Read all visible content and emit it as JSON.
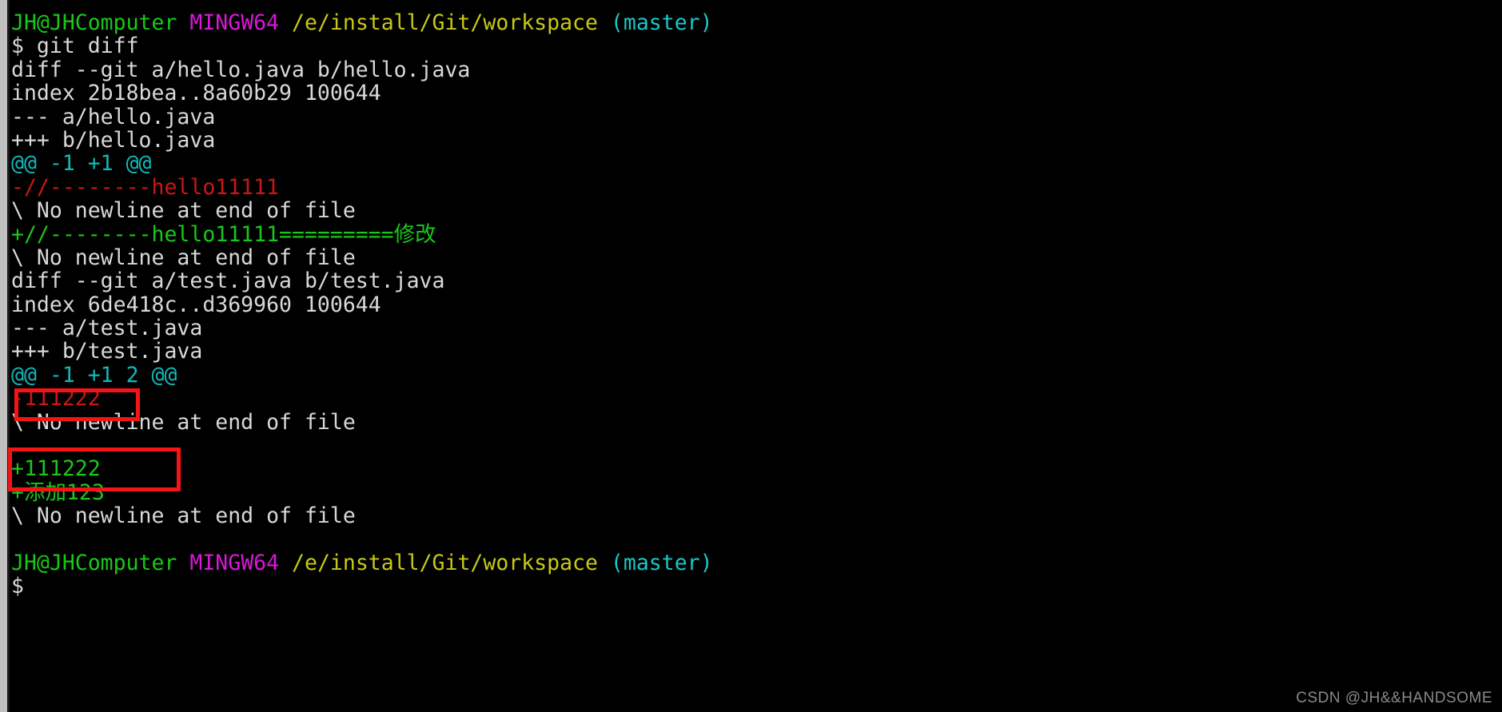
{
  "window": {
    "title": "MINGW64 /e/install/Git/workspace",
    "background_color": "#000000",
    "foreground_color": "#d8d8d8"
  },
  "colors": {
    "user_host": "#19c819",
    "shell_name": "#d818d8",
    "path": "#c8c818",
    "branch": "#19c8c8",
    "hunk_header": "#12b8b8",
    "removed": "#cc1616",
    "added": "#19c819",
    "normal": "#d8d8d8",
    "annotation_box": "#f41414",
    "watermark": "#8a8a8a"
  },
  "prompt": {
    "user_host": "JH@JHComputer",
    "shell": "MINGW64",
    "path": "/e/install/Git/workspace",
    "branch": "(master)",
    "symbol": "$"
  },
  "command": "git diff",
  "lines": [
    {
      "id": "prompt-1",
      "type": "prompt"
    },
    {
      "id": "cmd-1",
      "type": "command",
      "text": "$ git diff"
    },
    {
      "id": "l-diff-1",
      "type": "normal",
      "text": "diff --git a/hello.java b/hello.java"
    },
    {
      "id": "l-index-1",
      "type": "normal",
      "text": "index 2b18bea..8a60b29 100644"
    },
    {
      "id": "l-old-1",
      "type": "normal",
      "text": "--- a/hello.java"
    },
    {
      "id": "l-new-1",
      "type": "normal",
      "text": "+++ b/hello.java"
    },
    {
      "id": "l-hunk-1",
      "type": "hunk",
      "text": "@@ -1 +1 @@"
    },
    {
      "id": "l-del-1",
      "type": "removed",
      "text": "-//--------hello11111"
    },
    {
      "id": "l-nonl-1",
      "type": "normal",
      "text": "\\ No newline at end of file"
    },
    {
      "id": "l-add-1",
      "type": "added",
      "text": "+//--------hello11111=========修改"
    },
    {
      "id": "l-nonl-2",
      "type": "normal",
      "text": "\\ No newline at end of file"
    },
    {
      "id": "l-diff-2",
      "type": "normal",
      "text": "diff --git a/test.java b/test.java"
    },
    {
      "id": "l-index-2",
      "type": "normal",
      "text": "index 6de418c..d369960 100644"
    },
    {
      "id": "l-old-2",
      "type": "normal",
      "text": "--- a/test.java"
    },
    {
      "id": "l-new-2",
      "type": "normal",
      "text": "+++ b/test.java"
    },
    {
      "id": "l-hunk-2",
      "type": "hunk",
      "text": "@@ -1 +1 2 @@"
    },
    {
      "id": "l-del-2",
      "type": "removed",
      "text": "-111222"
    },
    {
      "id": "l-nonl-3",
      "type": "normal",
      "text": "\\ No newline at end of file"
    },
    {
      "id": "l-blank-1",
      "type": "normal",
      "text": ""
    },
    {
      "id": "l-add-2",
      "type": "added",
      "text": "+111222"
    },
    {
      "id": "l-add-3",
      "type": "added",
      "text": "+添加123"
    },
    {
      "id": "l-nonl-4",
      "type": "normal",
      "text": "\\ No newline at end of file"
    },
    {
      "id": "l-blank-2",
      "type": "normal",
      "text": ""
    },
    {
      "id": "prompt-2",
      "type": "prompt"
    },
    {
      "id": "cursor-1",
      "type": "command",
      "text": "$"
    }
  ],
  "text": {
    "diff_hello_header": "diff --git a/hello.java b/hello.java",
    "index_hello": "index 2b18bea..8a60b29 100644",
    "old_hello": "--- a/hello.java",
    "new_hello": "+++ b/hello.java",
    "hunk_hello": "@@ -1 +1 @@",
    "removed_hello": "-//--------hello11111",
    "added_hello": "+//--------hello11111=========修改",
    "no_newline": "\\ No newline at end of file",
    "diff_test_header": "diff --git a/test.java b/test.java",
    "index_test": "index 6de418c..d369960 100644",
    "old_test": "--- a/test.java",
    "new_test": "+++ b/test.java",
    "hunk_test": "@@ -1 +1 2 @@",
    "removed_test": "-111222",
    "added_test": "+111222",
    "added_test_cn": "+添加123",
    "command_line": "$ git diff",
    "cursor_line": "$"
  },
  "annotations": [
    {
      "id": "anno-1",
      "label": "highlight-removed-111222"
    },
    {
      "id": "anno-2",
      "label": "highlight-added-111222-and-add123"
    }
  ],
  "watermark": "CSDN @JH&&HANDSOME"
}
